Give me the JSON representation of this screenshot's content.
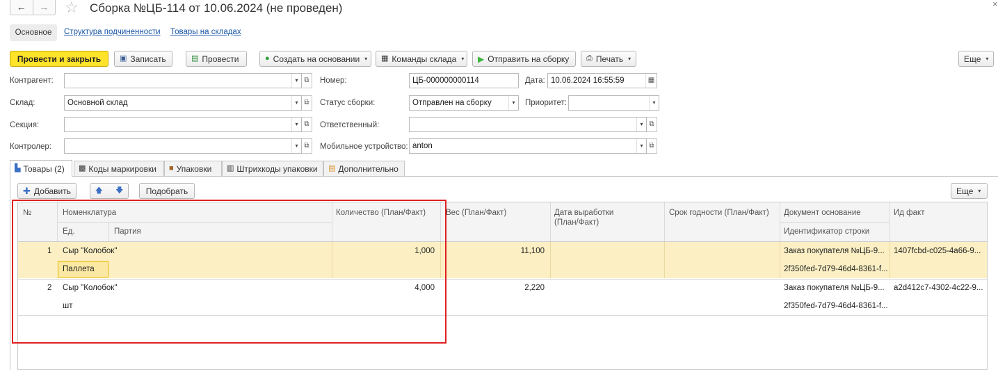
{
  "window": {
    "title": "Сборка №ЦБ-114 от 10.06.2024 (не проведен)",
    "back_icon": "arrow-left-icon",
    "forward_icon": "arrow-right-icon",
    "close_glyph": "×"
  },
  "sections": [
    {
      "label": "Основное",
      "active": true
    },
    {
      "label": "Структура подчиненности",
      "active": false
    },
    {
      "label": "Товары на складах",
      "active": false
    }
  ],
  "toolbar": {
    "post_close": "Провести и закрыть",
    "save": "Записать",
    "post": "Провести",
    "create_based": "Создать на основании",
    "warehouse_cmds": "Команды склада",
    "send_assembly": "Отправить на сборку",
    "print": "Печать",
    "more": "Еще"
  },
  "form": {
    "counterparty_label": "Контрагент:",
    "counterparty_value": "",
    "warehouse_label": "Склад:",
    "warehouse_value": "Основной склад",
    "section_label": "Секция:",
    "section_value": "",
    "controller_label": "Контролер:",
    "controller_value": "",
    "number_label": "Номер:",
    "number_value": "ЦБ-000000000114",
    "date_label": "Дата:",
    "date_value": "10.06.2024 16:55:59",
    "status_label": "Статус сборки:",
    "status_value": "Отправлен на сборку",
    "priority_label": "Приоритет:",
    "priority_value": "",
    "responsible_label": "Ответственный:",
    "responsible_value": "",
    "device_label": "Мобильное устройство:",
    "device_value": "anton"
  },
  "tabs": [
    {
      "label": "Товары (2)",
      "active": true
    },
    {
      "label": "Коды маркировки",
      "active": false
    },
    {
      "label": "Упаковки",
      "active": false
    },
    {
      "label": "Штрихкоды упаковки",
      "active": false
    },
    {
      "label": "Дополнительно",
      "active": false
    }
  ],
  "grid_toolbar": {
    "add": "Добавить",
    "pick": "Подобрать",
    "more": "Еще"
  },
  "grid": {
    "headers": {
      "num": "№",
      "nomenclature": "Номенклатура",
      "unit": "Ед.",
      "batch": "Партия",
      "qty": "Количество (План/Факт)",
      "weight": "Вес (План/Факт)",
      "prod_date_1": "Дата выработки",
      "prod_date_2": "(План/Факт)",
      "shelf_life": "Срок годности  (План/Факт)",
      "base_doc": "Документ основание",
      "row_id": "Идентификатор строки",
      "fact_id": "Ид факт"
    },
    "rows": [
      {
        "num": "1",
        "name": "Сыр \"Колобок\"",
        "unit": "Паллета",
        "qty": "1,000",
        "weight": "11,100",
        "base_doc": "Заказ покупателя №ЦБ-9...",
        "row_id": "2f350fed-7d79-46d4-8361-f...",
        "fact_id": "1407fcbd-c025-4a66-9..."
      },
      {
        "num": "2",
        "name": "Сыр \"Колобок\"",
        "unit": "шт",
        "qty": "4,000",
        "weight": "2,220",
        "base_doc": "Заказ покупателя №ЦБ-9...",
        "row_id": "2f350fed-7d79-46d4-8361-f...",
        "fact_id": "a2d412c7-4302-4c22-9..."
      }
    ]
  },
  "colors": {
    "primary_button": "#ffe22a",
    "selected_row": "#fbefc3",
    "highlight_frame": "#e02020",
    "link": "#1a56a8"
  }
}
